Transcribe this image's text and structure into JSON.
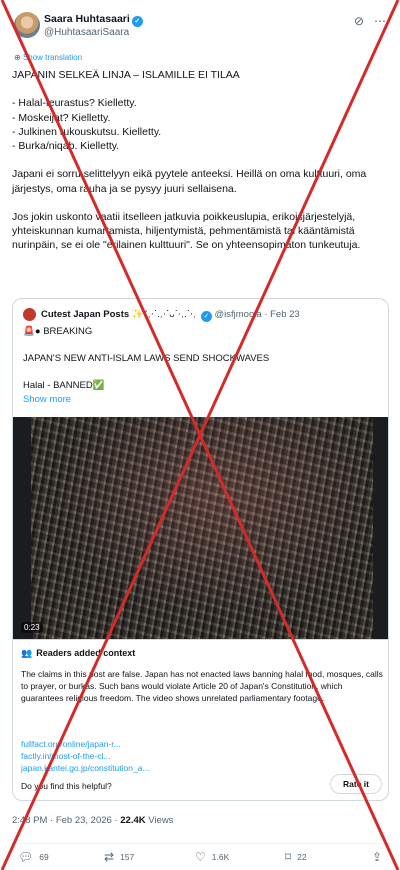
{
  "author": {
    "name": "Saara Huhtasaari",
    "handle": "@HuhtasaariSaara"
  },
  "show_translation": "Show translation",
  "tweet_text": "JAPANIN SELKEÄ LINJA – ISLAMILLE EI TILAA\n\n- Halal-teurastus? Kielletty.\n- Moskeijat? Kielletty.\n- Julkinen rukouskutsu. Kielletty.\n- Burka/niqab. Kielletty.\n\nJapani ei sorru selittelyyn eikä pyytele anteeksi. Heillä on oma kulttuuri, oma järjestys, oma rauha ja se pysyy juuri sellaisena.\n\nJos jokin uskonto vaatii itselleen jatkuvia poikkeuslupia, erikoisjärjestelyjä, yhteiskunnan kumartamista, hiljentymistä, pehmentämistä tai kääntämistä nurinpäin, se ei ole \"erilainen kulttuuri\". Se on yhteensopimaton tunkeutuja.",
  "quote": {
    "name": "Cutest Japan Posts",
    "name_suffix": "✨ᐟ⋰.⋰ᴗ⋱.⋱",
    "handle": "@isfjmoola",
    "date": "Feb 23",
    "text": "🚨● BREAKING\n\nJAPAN'S NEW ANTI-ISLAM LAWS SEND SHOCKWAVES\n\nHalal - BANNED✅",
    "show_more": "Show more",
    "video_time": "0:23"
  },
  "context": {
    "title": "Readers added context",
    "body": "The claims in this post are false. Japan has not enacted laws banning halal food, mosques, calls to prayer, or burkas. Such bans would violate Article 20 of Japan's Constitution, which guarantees religious freedom. The video shows unrelated parliamentary footage.",
    "links": [
      "fullfact.org/online/japan-r...",
      "factly.in/most-of-the-cl...",
      "japan.kantei.go.jp/constitution_a..."
    ],
    "question": "Do you find this helpful?",
    "rate_label": "Rate it"
  },
  "meta": {
    "time": "2:48 PM · Feb 23, 2026 · ",
    "views_count": "22.4K",
    "views_label": " Views"
  },
  "actions": {
    "replies": "69",
    "reposts": "157",
    "likes": "1.6K",
    "bookmarks": "22"
  },
  "colors": {
    "accent": "#1d9bf0",
    "cross": "#d42a2a"
  }
}
